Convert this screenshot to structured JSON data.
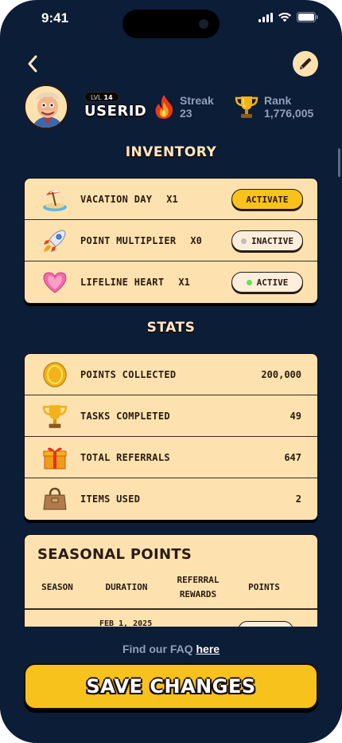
{
  "status": {
    "time": "9:41"
  },
  "profile": {
    "level_label": "LVL",
    "level": "14",
    "username": "USERID",
    "streak_label": "Streak",
    "streak_value": "23",
    "rank_label": "Rank",
    "rank_value": "1,776,005"
  },
  "inventory": {
    "title": "INVENTORY",
    "items": [
      {
        "icon": "beach-umbrella-icon",
        "name": "VACATION DAY",
        "qty": "X1",
        "status": "ACTIVATE"
      },
      {
        "icon": "rocket-icon",
        "name": "POINT MULTIPLIER",
        "qty": "X0",
        "status": "INACTIVE"
      },
      {
        "icon": "heart-icon",
        "name": "LIFELINE HEART",
        "qty": "X1",
        "status": "ACTIVE"
      }
    ]
  },
  "stats": {
    "title": "STATS",
    "items": [
      {
        "icon": "coin-icon",
        "name": "POINTS COLLECTED",
        "value": "200,000"
      },
      {
        "icon": "trophy-icon",
        "name": "TASKS COMPLETED",
        "value": "49"
      },
      {
        "icon": "gift-icon",
        "name": "TOTAL REFERRALS",
        "value": "647"
      },
      {
        "icon": "bag-icon",
        "name": "ITEMS USED",
        "value": "2"
      }
    ]
  },
  "seasonal": {
    "title": "SEASONAL POINTS",
    "headers": [
      "SEASON",
      "DURATION",
      "REFERRAL REWARDS",
      "POINTS"
    ],
    "partial_row_date": "FEB 1, 2025"
  },
  "footer": {
    "faq_text": "Find our FAQ",
    "faq_link": "here",
    "save_label": "SAVE CHANGES"
  },
  "colors": {
    "background": "#0c1d37",
    "card": "#fde2b0",
    "accent": "#f8c21c",
    "active_dot": "#6fdc5a"
  }
}
